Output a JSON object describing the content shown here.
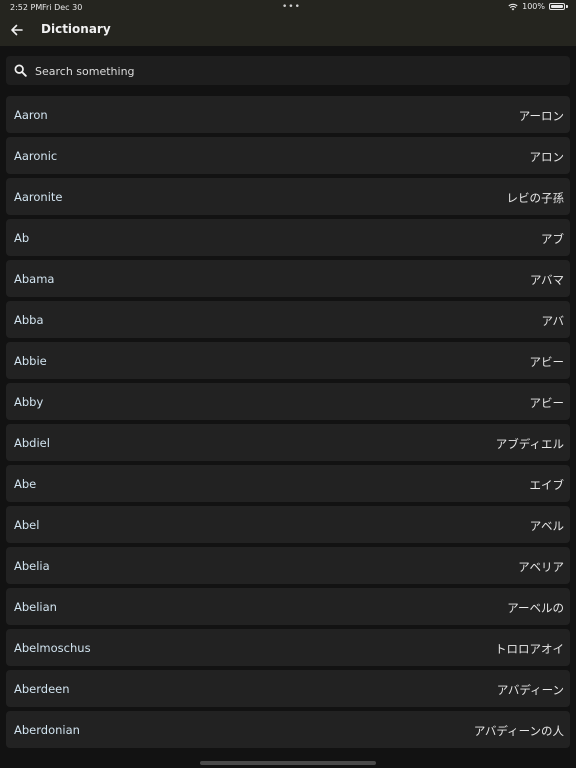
{
  "status_bar": {
    "time": "2:52 PM",
    "date": "Fri Dec 30",
    "battery": "100%"
  },
  "app_bar": {
    "title": "Dictionary",
    "back_icon": "arrow-left-icon"
  },
  "search": {
    "placeholder": "Search something",
    "value": "",
    "icon": "search-icon"
  },
  "entries": [
    {
      "word": "Aaron",
      "translation": "アーロン"
    },
    {
      "word": "Aaronic",
      "translation": "アロン"
    },
    {
      "word": "Aaronite",
      "translation": "レビの子孫"
    },
    {
      "word": "Ab",
      "translation": "アブ"
    },
    {
      "word": "Abama",
      "translation": "アバマ"
    },
    {
      "word": "Abba",
      "translation": "アバ"
    },
    {
      "word": "Abbie",
      "translation": "アビー"
    },
    {
      "word": "Abby",
      "translation": "アビー"
    },
    {
      "word": "Abdiel",
      "translation": "アブディエル"
    },
    {
      "word": "Abe",
      "translation": "エイブ"
    },
    {
      "word": "Abel",
      "translation": "アベル"
    },
    {
      "word": "Abelia",
      "translation": "アベリア"
    },
    {
      "word": "Abelian",
      "translation": "アーベルの"
    },
    {
      "word": "Abelmoschus",
      "translation": "トロロアオイ"
    },
    {
      "word": "Aberdeen",
      "translation": "アバディーン"
    },
    {
      "word": "Aberdonian",
      "translation": "アバディーンの人"
    }
  ],
  "colors": {
    "background": "#121212",
    "app_bar": "#25251f",
    "row": "#222222",
    "word_text": "#d2e4f0"
  }
}
